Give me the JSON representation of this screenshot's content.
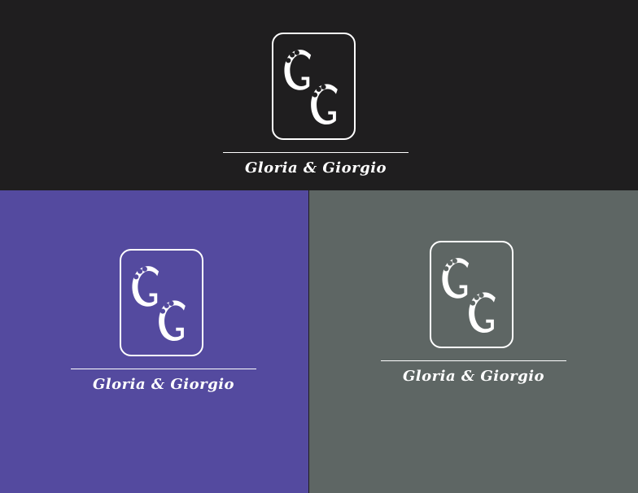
{
  "brand_name": "Gloria & Giorgio",
  "logo_text": "GG",
  "colors": {
    "dark": "#1f1e1f",
    "purple": "#544a9f",
    "gray": "#5e6664",
    "logo": "#ffffff"
  },
  "panels": [
    {
      "name": "dark",
      "brand": "Gloria & Giorgio"
    },
    {
      "name": "purple",
      "brand": "Gloria & Giorgio"
    },
    {
      "name": "gray",
      "brand": "Gloria & Giorgio"
    }
  ]
}
